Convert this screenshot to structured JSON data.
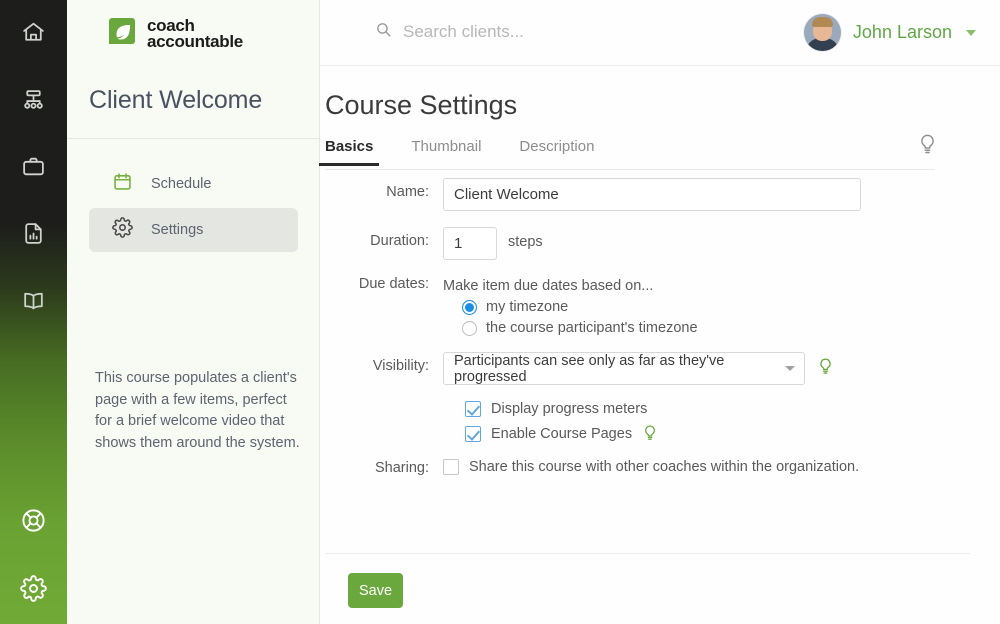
{
  "app": {
    "brand_line1": "coach",
    "brand_line2": "accountable",
    "brand_color": "#6aa83d",
    "accent_green": "#5fa844",
    "radio_blue": "#1a8fe3",
    "checkbox_blue": "#63a7e0"
  },
  "rail": {
    "items": [
      {
        "name": "home-icon",
        "label": "Home"
      },
      {
        "name": "org-chart-icon",
        "label": "Teams"
      },
      {
        "name": "briefcase-icon",
        "label": "Clients"
      },
      {
        "name": "report-icon",
        "label": "Reports"
      },
      {
        "name": "book-icon",
        "label": "Library"
      }
    ],
    "bottom_items": [
      {
        "name": "lifebuoy-icon",
        "label": "Help"
      },
      {
        "name": "gear-icon",
        "label": "Settings"
      }
    ]
  },
  "sidebar": {
    "course_title": "Client Welcome",
    "items": [
      {
        "label": "Schedule",
        "icon": "calendar-icon",
        "active": false
      },
      {
        "label": "Settings",
        "icon": "gear-icon",
        "active": true
      }
    ],
    "description": "This course populates a client's page with a few items, perfect for a brief welcome video that shows them around the system."
  },
  "topbar": {
    "search_placeholder": "Search clients...",
    "search_value": "",
    "username": "John Larson"
  },
  "page": {
    "title": "Course Settings",
    "tabs": [
      {
        "label": "Basics",
        "active": true
      },
      {
        "label": "Thumbnail",
        "active": false
      },
      {
        "label": "Description",
        "active": false
      }
    ]
  },
  "form": {
    "name": {
      "label": "Name:",
      "value": "Client Welcome",
      "placeholder": ""
    },
    "duration": {
      "label": "Duration:",
      "value": "1",
      "unit": "steps"
    },
    "due_dates": {
      "label": "Due dates:",
      "heading": "Make item due dates based on...",
      "options": [
        {
          "label": "my timezone",
          "checked": true
        },
        {
          "label": "the course participant's timezone",
          "checked": false
        }
      ]
    },
    "visibility": {
      "label": "Visibility:",
      "selected": "Participants can see only as far as they've progressed"
    },
    "toggles": [
      {
        "label": "Display progress meters",
        "checked": true,
        "hint": false
      },
      {
        "label": "Enable Course Pages",
        "checked": true,
        "hint": true
      }
    ],
    "sharing": {
      "label": "Sharing:",
      "checkbox_label": "Share this course with other coaches within the organization.",
      "checked": false
    },
    "save_label": "Save"
  }
}
